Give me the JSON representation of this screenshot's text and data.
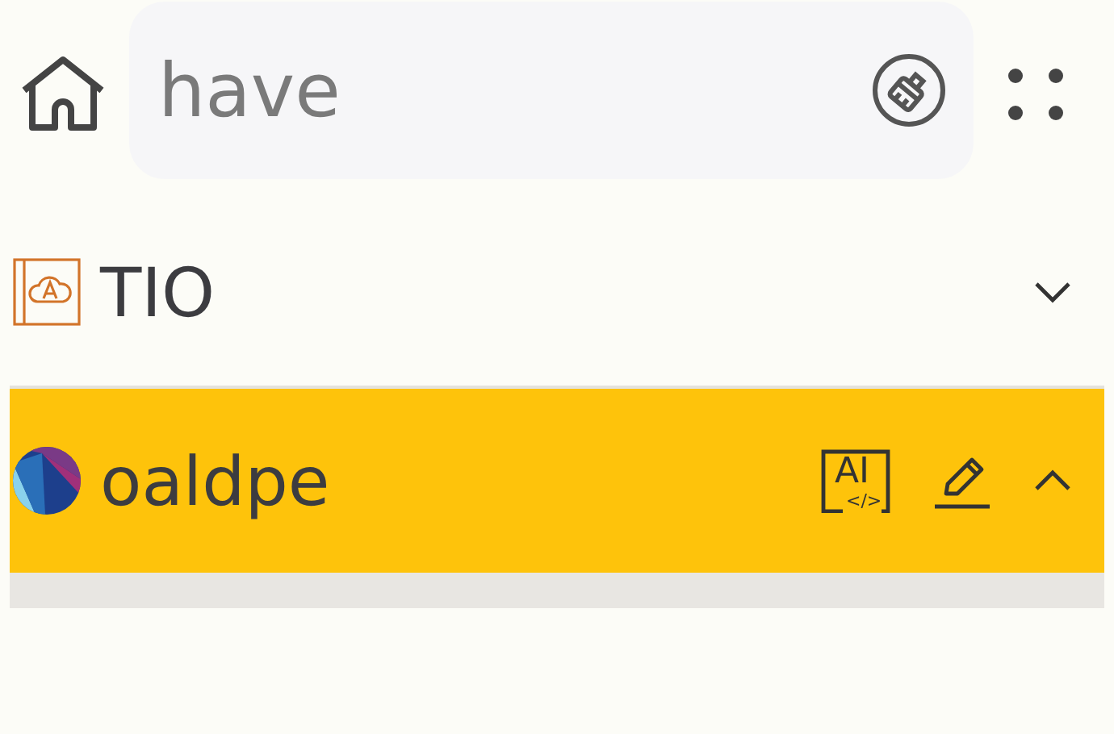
{
  "search": {
    "value": "have"
  },
  "dictionaries": [
    {
      "name": "TIO",
      "kind": "book",
      "selected": false,
      "expanded": false
    },
    {
      "name": "oaldpe",
      "kind": "globe",
      "selected": true,
      "expanded": true,
      "ai_badge": {
        "label": "AI",
        "code": "</>"
      }
    }
  ]
}
